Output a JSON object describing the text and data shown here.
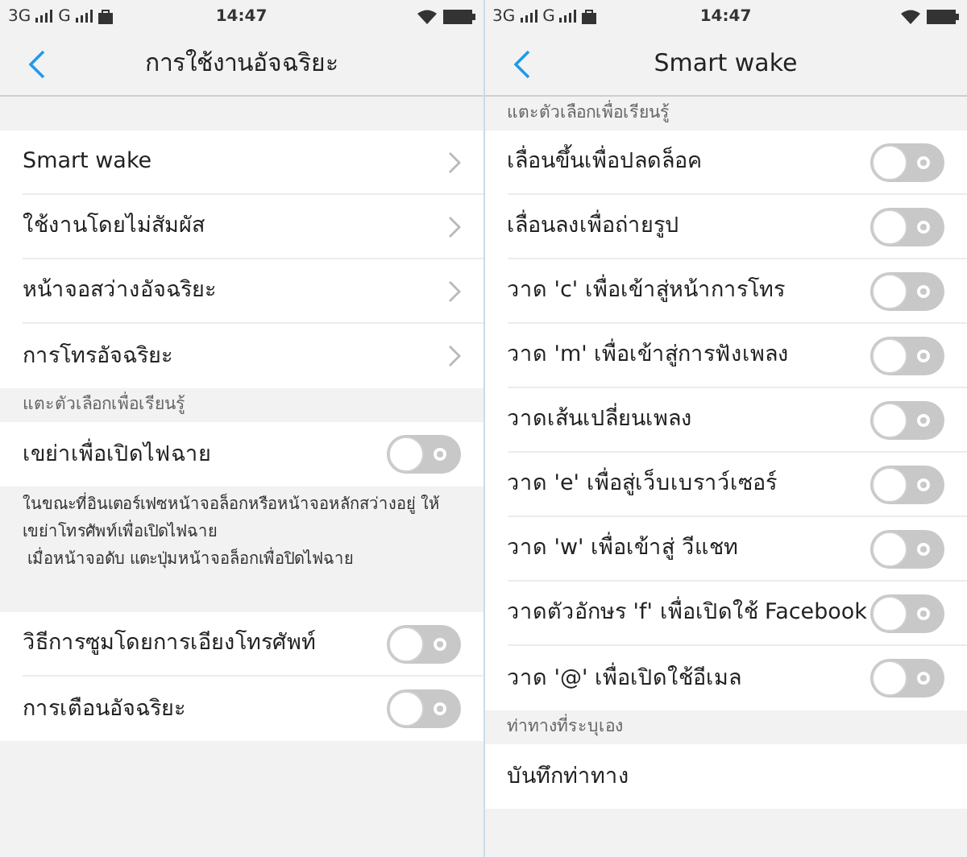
{
  "screens": [
    {
      "status_bar": {
        "network_1": "3G",
        "network_2": "G",
        "time": "14:47"
      },
      "header": {
        "title": "การใช้งานอัจฉริยะ"
      },
      "sections": [
        {
          "items": [
            {
              "kind": "link",
              "label": "Smart wake"
            },
            {
              "kind": "link",
              "label": "ใช้งานโดยไม่สัมผัส"
            },
            {
              "kind": "link",
              "label": "หน้าจอสว่างอัจฉริยะ"
            },
            {
              "kind": "link",
              "label": "การโทรอัจฉริยะ"
            }
          ]
        },
        {
          "heading": "แตะตัวเลือกเพื่อเรียนรู้",
          "items": [
            {
              "kind": "toggle",
              "label": "เขย่าเพื่อเปิดไฟฉาย",
              "on": false
            }
          ],
          "note": [
            "ในขณะที่อินเตอร์เฟซหน้าจอล็อกหรือหน้าจอหลักสว่างอยู่ ให้",
            "เขย่าโทรศัพท์เพื่อเปิดไฟฉาย",
            " เมื่อหน้าจอดับ แตะปุ่มหน้าจอล็อกเพื่อปิดไฟฉาย"
          ]
        },
        {
          "items": [
            {
              "kind": "toggle",
              "label": "วิธีการซูมโดยการเอียงโทรศัพท์",
              "on": false
            },
            {
              "kind": "toggle",
              "label": "การเตือนอัจฉริยะ",
              "on": false
            }
          ]
        }
      ]
    },
    {
      "status_bar": {
        "network_1": "3G",
        "network_2": "G",
        "time": "14:47"
      },
      "header": {
        "title": "Smart wake"
      },
      "sections": [
        {
          "heading": "แตะตัวเลือกเพื่อเรียนรู้",
          "items": [
            {
              "kind": "toggle",
              "label": "เลื่อนขึ้นเพื่อปลดล็อค",
              "on": false
            },
            {
              "kind": "toggle",
              "label": "เลื่อนลงเพื่อถ่ายรูป",
              "on": false
            },
            {
              "kind": "toggle",
              "label": "วาด 'c' เพื่อเข้าสู่หน้าการโทร",
              "on": false
            },
            {
              "kind": "toggle",
              "label": "วาด 'm' เพื่อเข้าสู่การฟังเพลง",
              "on": false
            },
            {
              "kind": "toggle",
              "label": "วาดเส้นเปลี่ยนเพลง",
              "on": false
            },
            {
              "kind": "toggle",
              "label": "วาด 'e' เพื่อสู่เว็บเบราว์เซอร์",
              "on": false
            },
            {
              "kind": "toggle",
              "label": "วาด 'w' เพื่อเข้าสู่ วีแชท",
              "on": false
            },
            {
              "kind": "toggle",
              "label": "วาดตัวอักษร 'f' เพื่อเปิดใช้ Facebook",
              "on": false
            },
            {
              "kind": "toggle",
              "label": "วาด '@' เพื่อเปิดใช้อีเมล",
              "on": false
            }
          ]
        },
        {
          "heading": "ท่าทางที่ระบุเอง",
          "items": [
            {
              "kind": "plain",
              "label": "บันทึกท่าทาง"
            }
          ]
        }
      ]
    }
  ]
}
